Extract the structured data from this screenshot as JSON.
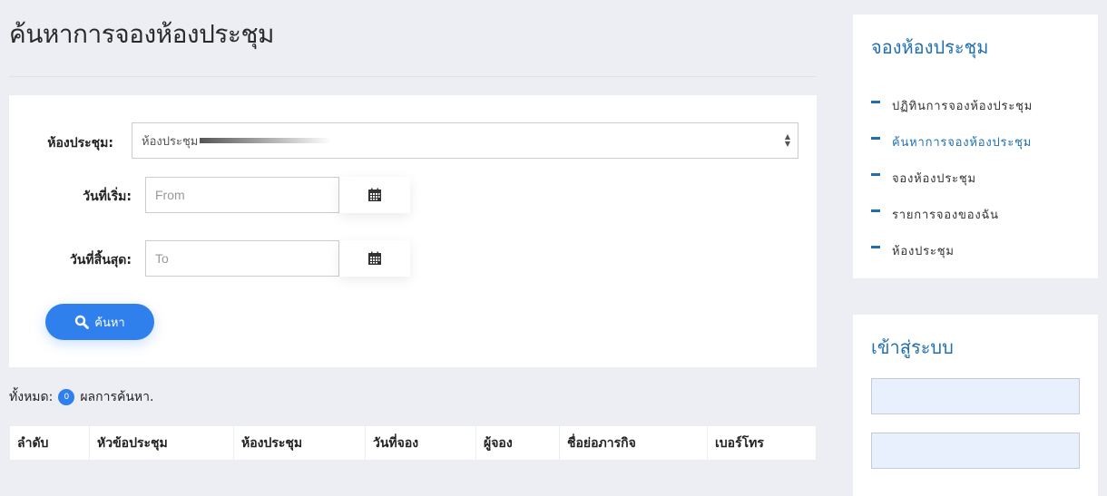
{
  "page": {
    "title": "ค้นหาการจองห้องประชุม"
  },
  "search_form": {
    "room_label": "ห้องประชุม:",
    "room_selected": "ห้องประชุม",
    "start_label": "วันที่เริ่ม:",
    "start_placeholder": "From",
    "end_label": "วันที่สิ้นสุด:",
    "end_placeholder": "To",
    "search_button": "ค้นหา"
  },
  "results": {
    "total_prefix": "ทั้งหมด:",
    "count": "0",
    "total_suffix": "ผลการค้นหา.",
    "columns": [
      "ลำดับ",
      "หัวข้อประชุม",
      "ห้องประชุม",
      "วันที่จอง",
      "ผู้จอง",
      "ชื่อย่อภารกิจ",
      "เบอร์โทร"
    ]
  },
  "sidebar": {
    "booking_heading": "จองห้องประชุม",
    "items": [
      {
        "label": "ปฏิทินการจองห้องประชุม",
        "active": false
      },
      {
        "label": "ค้นหาการจองห้องประชุม",
        "active": true
      },
      {
        "label": "จองห้องประชุม",
        "active": false
      },
      {
        "label": "รายการจองของฉัน",
        "active": false
      },
      {
        "label": "ห้องประชุม",
        "active": false
      }
    ],
    "login_heading": "เข้าสู่ระบบ"
  },
  "colors": {
    "accent": "#2f80ed",
    "sidebar_blue": "#1f6fb2",
    "background": "#edeef3"
  }
}
